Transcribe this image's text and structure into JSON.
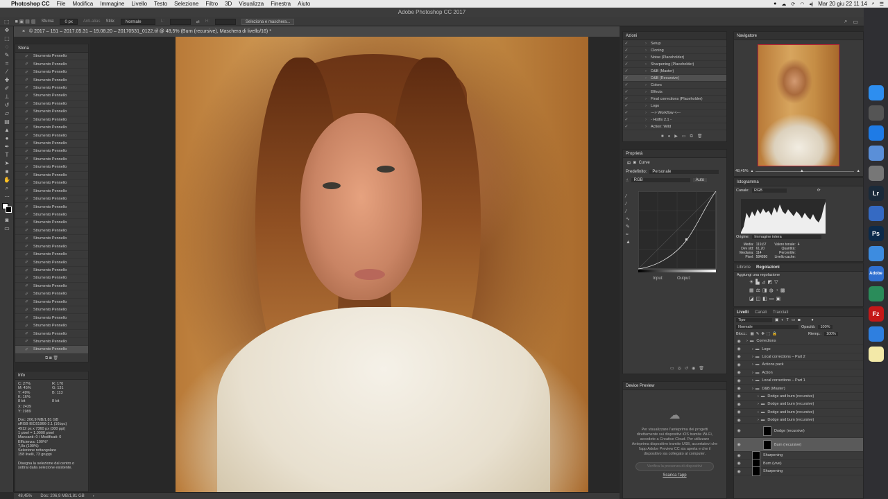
{
  "menubar": {
    "apple": "",
    "app_name": "Photoshop CC",
    "items": [
      "File",
      "Modifica",
      "Immagine",
      "Livello",
      "Testo",
      "Selezione",
      "Filtro",
      "3D",
      "Visualizza",
      "Finestra",
      "Aiuto"
    ],
    "clock": "Mar 20 giu  22 11 14"
  },
  "window": {
    "title": "Adobe Photoshop CC 2017"
  },
  "options": {
    "sfuma_label": "Sfuma:",
    "sfuma_value": "0 px",
    "antialias": "Anti-alias",
    "stile_label": "Stile:",
    "stile_value": "Normale",
    "width_label": "L:",
    "height_label": "H:",
    "mask_button": "Seleziona e maschera..."
  },
  "document": {
    "tab_title": "© 2017 – 151 – 2017.05.31 – 19.08.20 – 20170531_0122.tif @ 48,5% (Burn (recursive), Maschera di livello/16) *"
  },
  "history": {
    "title": "Storia",
    "item_label": "Strumento Pennello",
    "count": 38
  },
  "info": {
    "title": "Info",
    "cmyk": {
      "c": "27%",
      "m": "45%",
      "y": "49%",
      "k": "16%"
    },
    "rgb": {
      "r": "170",
      "g": "131",
      "b": "113"
    },
    "bit_left": "8 bit",
    "bit_right": "8 bit",
    "x": "2439",
    "y": "1989",
    "lines": [
      "Doc: 206,9 MB/1,81 GB",
      "sRGB IEC61966-2.1 (16bpc)",
      "4912 px x 7360 px (300 ppi)",
      "1 pixel = 1,0000 pixel",
      "Mancanti: 0 / Modificati: 0",
      "Efficienza: 100%*",
      "7,8s (100%)",
      "Selezione rettangolare",
      "158 livelli, 73 gruppi"
    ],
    "hint": "Disegna la selezione dal centro o sottrai dalla selezione esistente."
  },
  "status": {
    "zoom": "48,45%",
    "doc": "Doc: 206,9 MB/1,81 GB"
  },
  "actions": {
    "title": "Azioni",
    "items": [
      "Setup",
      "Cloning",
      "Noise (Placeholder)",
      "Sharpening (Placeholder)",
      "D&B (Master)",
      "D&B (Recursive)",
      "Colors",
      "Effects",
      "Final corrections (Placeholder)",
      "Logo",
      "---> Workflow <---",
      "- Hotfix 2.1 -",
      "Action: Wild"
    ],
    "selected_index": 5
  },
  "properties": {
    "title": "Proprietà",
    "kind": "Curve",
    "preset_label": "Predefinito:",
    "preset_value": "Personale",
    "channel": "RGB",
    "auto": "Auto",
    "input_label": "Input:",
    "output_label": "Output:"
  },
  "device_preview": {
    "title": "Device Preview",
    "text": "Per visualizzare l'anteprima dei progetti direttamente sui dispositivi iOS tramite Wi-Fi, accedete a Creative Cloud. Per utilizzare Anteprima dispositivo tramite USB, accertatevi che l'app Adobe Preview CC sia aperta e che il dispositivo sia collegato al computer.",
    "button": "Verifica la presenza di dispositivi",
    "link": "Scarica l'app"
  },
  "navigator": {
    "title": "Navigatore",
    "zoom": "48,45%"
  },
  "histogram": {
    "title": "Istogramma",
    "canale_label": "Canale:",
    "canale_value": "RGB",
    "origine_label": "Origine:",
    "origine_value": "Immagine intera",
    "stats_left": [
      "Media:",
      "Dev std:",
      "Mediana:",
      "Pixel:"
    ],
    "stats_left_vals": [
      "119,67",
      "61,20",
      "114",
      "584880"
    ],
    "stats_right": [
      "Valore tonale:",
      "Quantità:",
      "Percentile:",
      "Livello cache:"
    ],
    "stats_right_vals": [
      "",
      "",
      "",
      "4"
    ]
  },
  "adjustments": {
    "tab_libraries": "Librerie",
    "tab_adjust": "Regolazioni",
    "add_label": "Aggiungi una regolazione"
  },
  "layers": {
    "tabs": [
      "Livelli",
      "Canali",
      "Tracciati"
    ],
    "filter": "Tipo",
    "blend": "Normale",
    "opacity_label": "Opacità:",
    "opacity_value": "100%",
    "lock_label": "Blocc.:",
    "fill_label": "Riemp.:",
    "fill_value": "100%",
    "items": [
      {
        "name": "Corrections",
        "indent": 0,
        "type": "group"
      },
      {
        "name": "Logo",
        "indent": 1,
        "type": "group"
      },
      {
        "name": "Local corrections – Part 2",
        "indent": 1,
        "type": "group"
      },
      {
        "name": "Actions pack",
        "indent": 1,
        "type": "group"
      },
      {
        "name": "Action",
        "indent": 1,
        "type": "group"
      },
      {
        "name": "Local corrections – Part 1",
        "indent": 1,
        "type": "group"
      },
      {
        "name": "D&B (Master)",
        "indent": 1,
        "type": "group"
      },
      {
        "name": "Dodge and burn (recursive)",
        "indent": 2,
        "type": "group"
      },
      {
        "name": "Dodge and burn (recursive)",
        "indent": 2,
        "type": "group"
      },
      {
        "name": "Dodge and burn (recursive)",
        "indent": 2,
        "type": "group"
      },
      {
        "name": "Dodge and burn (recursive)",
        "indent": 2,
        "type": "group"
      },
      {
        "name": "Dodge (recursive)",
        "indent": 3,
        "type": "curve"
      },
      {
        "name": "Burn (recursive)",
        "indent": 3,
        "type": "curve"
      },
      {
        "name": "Sharpening",
        "indent": 1,
        "type": "layer"
      },
      {
        "name": "Burn (vive)",
        "indent": 1,
        "type": "layer"
      },
      {
        "name": "Sharpening",
        "indent": 1,
        "type": "layer"
      }
    ],
    "selected_index": 12
  },
  "dock": [
    {
      "name": "finder",
      "label": "",
      "color": "#2d8ef0"
    },
    {
      "name": "launchpad",
      "label": "",
      "color": "#555"
    },
    {
      "name": "safari",
      "label": "",
      "color": "#1e7be6"
    },
    {
      "name": "preview",
      "label": "",
      "color": "#5a8fd8"
    },
    {
      "name": "system-preferences",
      "label": "",
      "color": "#777"
    },
    {
      "name": "lightroom",
      "label": "Lr",
      "color": "#1a2a3a"
    },
    {
      "name": "chrome",
      "label": "",
      "color": "#356ac3"
    },
    {
      "name": "photoshop",
      "label": "Ps",
      "color": "#0c2a4a"
    },
    {
      "name": "drive",
      "label": "",
      "color": "#3d8ce0"
    },
    {
      "name": "adobe",
      "label": "Adobe",
      "color": "#2f6fd0"
    },
    {
      "name": "sourcetree",
      "label": "",
      "color": "#2a8c5a"
    },
    {
      "name": "filezilla",
      "label": "Fz",
      "color": "#c41818"
    },
    {
      "name": "teamviewer",
      "label": "",
      "color": "#2e7fe0"
    },
    {
      "name": "notes",
      "label": "",
      "color": "#f3e9a8"
    }
  ]
}
